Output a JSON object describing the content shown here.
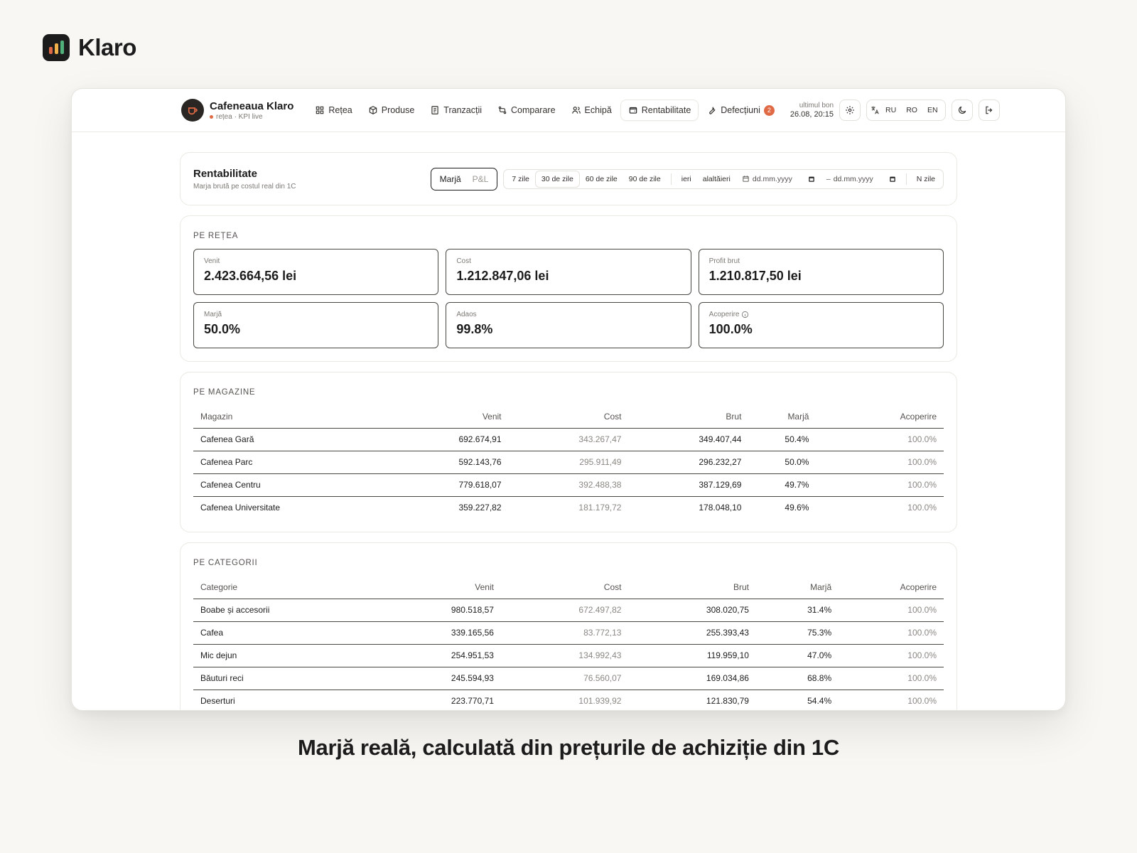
{
  "brand": {
    "name": "Klaro",
    "logo_bar_colors": [
      "#e06a45",
      "#f0b04a",
      "#4fb07a"
    ]
  },
  "topbar": {
    "shop_name": "Cafeneaua Klaro",
    "shop_sub": "rețea · KPI live",
    "nav": [
      {
        "label": "Rețea",
        "icon": "grid-icon"
      },
      {
        "label": "Produse",
        "icon": "box-icon"
      },
      {
        "label": "Tranzacții",
        "icon": "receipt-icon"
      },
      {
        "label": "Comparare",
        "icon": "compare-icon"
      },
      {
        "label": "Echipă",
        "icon": "users-icon"
      },
      {
        "label": "Rentabilitate",
        "icon": "wallet-icon",
        "active": true
      },
      {
        "label": "Defecțiuni",
        "icon": "wrench-icon",
        "badge": "2"
      }
    ],
    "last_receipt_label": "ultimul bon",
    "last_receipt_time": "26.08, 20:15",
    "languages": [
      "RU",
      "RO",
      "EN"
    ]
  },
  "header": {
    "title": "Rentabilitate",
    "subtitle": "Marja brută pe costul real din 1C",
    "mode": {
      "on": "Marjă",
      "off": "P&L"
    },
    "ranges": [
      "7 zile",
      "30 de zile",
      "60 de zile",
      "90 de zile"
    ],
    "selected_range": "30 de zile",
    "days": [
      "ieri",
      "alaltăieri"
    ],
    "date_placeholder": "dd.mm.yyyy",
    "date_sep": "–",
    "n_days": "N zile"
  },
  "network": {
    "label": "PE REȚEA",
    "kpis": [
      {
        "label": "Venit",
        "value": "2.423.664,56 lei"
      },
      {
        "label": "Cost",
        "value": "1.212.847,06 lei"
      },
      {
        "label": "Profit brut",
        "value": "1.210.817,50 lei"
      },
      {
        "label": "Marjă",
        "value": "50.0%"
      },
      {
        "label": "Adaos",
        "value": "99.8%"
      },
      {
        "label": "Acoperire",
        "value": "100.0%",
        "info": true
      }
    ]
  },
  "stores": {
    "label": "PE MAGAZINE",
    "columns": [
      "Magazin",
      "Venit",
      "Cost",
      "Brut",
      "Marjă",
      "Acoperire"
    ],
    "rows": [
      [
        "Cafenea Gară",
        "692.674,91",
        "343.267,47",
        "349.407,44",
        "50.4%",
        "100.0%"
      ],
      [
        "Cafenea Parc",
        "592.143,76",
        "295.911,49",
        "296.232,27",
        "50.0%",
        "100.0%"
      ],
      [
        "Cafenea Centru",
        "779.618,07",
        "392.488,38",
        "387.129,69",
        "49.7%",
        "100.0%"
      ],
      [
        "Cafenea Universitate",
        "359.227,82",
        "181.179,72",
        "178.048,10",
        "49.6%",
        "100.0%"
      ]
    ]
  },
  "categories": {
    "label": "PE CATEGORII",
    "columns": [
      "Categorie",
      "Venit",
      "Cost",
      "Brut",
      "Marjă",
      "Acoperire"
    ],
    "rows": [
      [
        "Boabe și accesorii",
        "980.518,57",
        "672.497,82",
        "308.020,75",
        "31.4%",
        "100.0%"
      ],
      [
        "Cafea",
        "339.165,56",
        "83.772,13",
        "255.393,43",
        "75.3%",
        "100.0%"
      ],
      [
        "Mic dejun",
        "254.951,53",
        "134.992,43",
        "119.959,10",
        "47.0%",
        "100.0%"
      ],
      [
        "Băuturi reci",
        "245.594,93",
        "76.560,07",
        "169.034,86",
        "68.8%",
        "100.0%"
      ],
      [
        "Deserturi",
        "223.770,71",
        "101.939,92",
        "121.830,79",
        "54.4%",
        "100.0%"
      ]
    ]
  },
  "caption": "Marjă reală, calculată din prețurile de achiziție din 1C"
}
